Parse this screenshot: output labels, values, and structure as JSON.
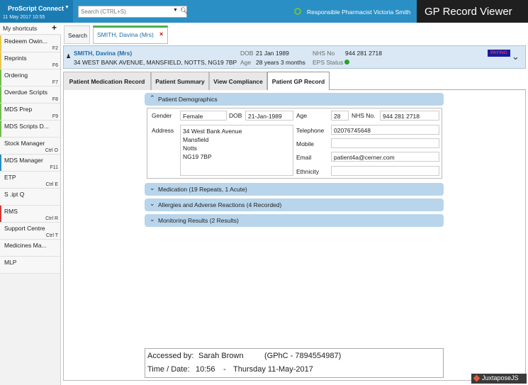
{
  "app": {
    "brand": "ProScript Connect",
    "date_time": "11 May 2017 10:55",
    "search_placeholder": "Search (CTRL+S)",
    "pharmacist": "Responsible Pharmacist Victoria Smith",
    "viewer_title": "GP Record Viewer"
  },
  "sidebar": {
    "header": "My shortcuts",
    "items": [
      {
        "label": "Redeem Owin...",
        "key": "F2",
        "accent": "#e8c94a"
      },
      {
        "label": "Reprints",
        "key": "F6",
        "accent": "#e8c94a"
      },
      {
        "label": "Ordering",
        "key": "F7",
        "accent": "#6fbf4a"
      },
      {
        "label": "Overdue Scripts",
        "key": "F8",
        "accent": "#6fbf4a"
      },
      {
        "label": "MDS Prep",
        "key": "F9",
        "accent": "#6fbf4a"
      },
      {
        "label": "MDS Scripts D...",
        "key": "",
        "accent": "#6fbf4a"
      },
      {
        "label": "Stock Manager",
        "key": "Ctrl O",
        "accent": ""
      },
      {
        "label": "MDS Manager",
        "key": "F11",
        "accent": "#2a8fc4"
      },
      {
        "label": "ETP",
        "key": "Ctrl E",
        "accent": ""
      },
      {
        "label": "S .ipt Q",
        "key": "",
        "accent": ""
      },
      {
        "label": "RMS",
        "key": "Ctrl R",
        "accent": "#d33"
      },
      {
        "label": "Support Centre",
        "key": "Ctrl T",
        "accent": ""
      },
      {
        "label": "Medicines Ma...",
        "key": "",
        "accent": ""
      },
      {
        "label": "MLP",
        "key": "",
        "accent": ""
      }
    ]
  },
  "tabs": {
    "search": "Search",
    "patient": "SMITH, Davina (Mrs)",
    "close": "×"
  },
  "patient": {
    "name": "SMITH, Davina (Mrs)",
    "address": "34 WEST BANK AVENUE, MANSFIELD, NOTTS, NG19 7BP",
    "dob_label": "DOB",
    "dob": "21 Jan 1989",
    "age_label": "Age",
    "age": "28 years 3 months",
    "nhs_label": "NHS No",
    "nhs": "944 281 2718",
    "eps_label": "EPS Status",
    "status_badge": "PAYING"
  },
  "subtabs": [
    "Patient Medication Record",
    "Patient Summary",
    "View Compliance",
    "Patient GP Record"
  ],
  "sections": {
    "demographics": "Patient Demographics",
    "medication": "Medication (19 Repeats, 1 Acute)",
    "allergies": "Allergies and Adverse Reactions (4 Recorded)",
    "monitoring": "Monitoring Results (2 Results)"
  },
  "demographics": {
    "gender_label": "Gender",
    "gender": "Female",
    "dob_label": "DOB",
    "dob": "21-Jan-1989",
    "age_label": "Age",
    "age": "28",
    "nhs_label": "NHS No.",
    "nhs": "944 281 2718",
    "address_label": "Address",
    "address": [
      "34 West Bank Avenue",
      "Mansfield",
      "Notts",
      "NG19 7BP"
    ],
    "telephone_label": "Telephone",
    "telephone": "02076745648",
    "mobile_label": "Mobile",
    "mobile": "",
    "email_label": "Email",
    "email": "patient4a@cerner.com",
    "ethnicity_label": "Ethnicity",
    "ethnicity": ""
  },
  "access": {
    "accessed_label": "Accessed by:",
    "accessed_by": "Sarah Brown",
    "gphc": "(GPhC - 7894554987)",
    "time_label": "Time / Date:",
    "time": "10:56",
    "sep": "-",
    "date": "Thursday 11-May-2017"
  },
  "watermark": "JuxtaposeJS"
}
